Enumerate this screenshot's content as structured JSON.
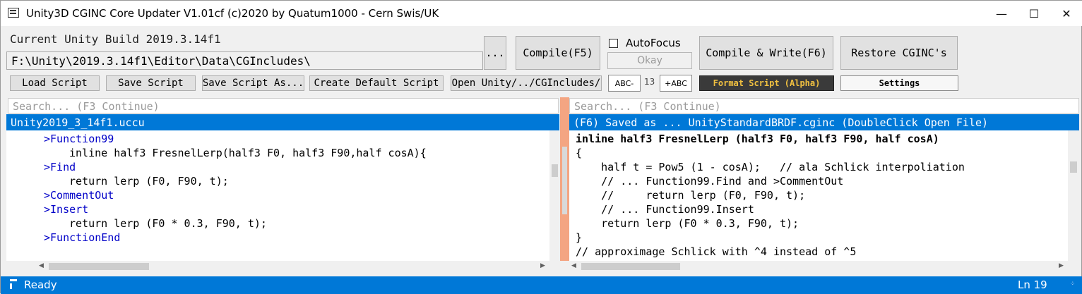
{
  "window": {
    "title": "Unity3D CGINC Core Updater V1.01cf (c)2020 by Quatum1000 - Cern Swis/UK",
    "minimize_glyph": "—",
    "maximize_glyph": "☐",
    "close_glyph": "✕"
  },
  "top": {
    "build_label": "Current Unity Build 2019.3.14f1",
    "path": "F:\\Unity\\2019.3.14f1\\Editor\\Data\\CGIncludes\\",
    "browse_label": "...",
    "compile_label": "Compile(F5)",
    "autofocus_label": "AutoFocus",
    "okay_label": "Okay",
    "compile_write_label": "Compile & Write(F6)",
    "restore_label": "Restore CGINC's"
  },
  "toolbar": {
    "load": "Load Script",
    "save": "Save Script",
    "save_as": "Save Script As...",
    "create_default": "Create Default Script",
    "open_unity": "Open Unity/../CGIncludes/",
    "font_smaller": "ABC-",
    "font_size": "13",
    "font_larger": "+ABC",
    "format": "Format Script (Alpha)",
    "settings": "Settings"
  },
  "left": {
    "search_placeholder": "Search... (F3 Continue)",
    "header": "Unity2019_3_14f1.uccu",
    "lines": [
      ">Function99",
      "inline half3 FresnelLerp(half3 F0, half3 F90,half cosA){",
      ">Find",
      "return lerp (F0, F90, t);",
      ">CommentOut",
      ">Insert",
      "return lerp (F0 * 0.3, F90, t);",
      ">FunctionEnd"
    ]
  },
  "right": {
    "search_placeholder": "Search... (F3 Continue)",
    "header": "(F6) Saved as ... UnityStandardBRDF.cginc   (DoubleClick Open File)",
    "lines": [
      "inline half3 FresnelLerp (half3 F0, half3 F90, half cosA)",
      "{",
      "    half t = Pow5 (1 - cosA);   // ala Schlick interpoliation",
      "    // ... Function99.Find and >CommentOut",
      "    //     return lerp (F0, F90, t);",
      "    // ... Function99.Insert",
      "    return lerp (F0 * 0.3, F90, t);",
      "}",
      "// approximage Schlick with ^4 instead of ^5"
    ]
  },
  "status": {
    "text": "Ready",
    "line": "Ln 19"
  },
  "colors": {
    "accent": "#0078d7",
    "splitter": "#f4a582",
    "format_bg": "#3a3a3a",
    "format_fg": "#f0c040",
    "keyword": "#0000c8"
  }
}
